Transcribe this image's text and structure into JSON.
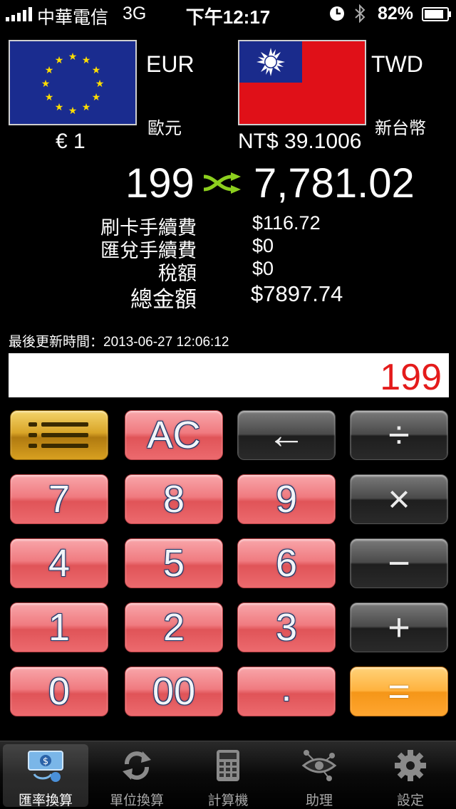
{
  "status_bar": {
    "carrier": "中華電信",
    "network": "3G",
    "time": "下午12:17",
    "battery": "82%"
  },
  "from_currency": {
    "code": "EUR",
    "name": "歐元",
    "rate": "€ 1",
    "flag": "eu-flag-icon"
  },
  "to_currency": {
    "code": "TWD",
    "name": "新台幣",
    "rate": "NT$ 39.1006",
    "flag": "taiwan-flag-icon"
  },
  "conversion": {
    "amount": "199",
    "result": "7,781.02",
    "swap_icon": "swap-arrows-icon"
  },
  "fees": [
    {
      "label": "刷卡手續費",
      "value": "$116.72"
    },
    {
      "label": "匯兌手續費",
      "value": "$0"
    },
    {
      "label": "稅額",
      "value": "$0"
    },
    {
      "label": "總金額",
      "value": "$7897.74"
    }
  ],
  "last_updated": "最後更新時間：2013-06-27 12:06:12",
  "display_value": "199",
  "keypad": {
    "menu": "menu-icon",
    "clear": "AC",
    "backspace": "←",
    "divide": "÷",
    "multiply": "×",
    "minus": "−",
    "plus": "+",
    "equals": "=",
    "digits": [
      "7",
      "8",
      "9",
      "4",
      "5",
      "6",
      "1",
      "2",
      "3",
      "0",
      "00",
      "."
    ]
  },
  "tabs": [
    {
      "label": "匯率換算",
      "icon": "currency-exchange-icon",
      "active": true
    },
    {
      "label": "單位換算",
      "icon": "refresh-icon",
      "active": false
    },
    {
      "label": "計算機",
      "icon": "calculator-icon",
      "active": false
    },
    {
      "label": "助理",
      "icon": "eye-network-icon",
      "active": false
    },
    {
      "label": "設定",
      "icon": "gear-icon",
      "active": false
    }
  ],
  "colors": {
    "display_text": "#e41b1b",
    "key_red": "#f07b80",
    "key_dark": "#3a3a3a",
    "key_gold": "#d9a528",
    "key_orange": "#ffb23e",
    "swap_icon": "#8ccf1e"
  }
}
